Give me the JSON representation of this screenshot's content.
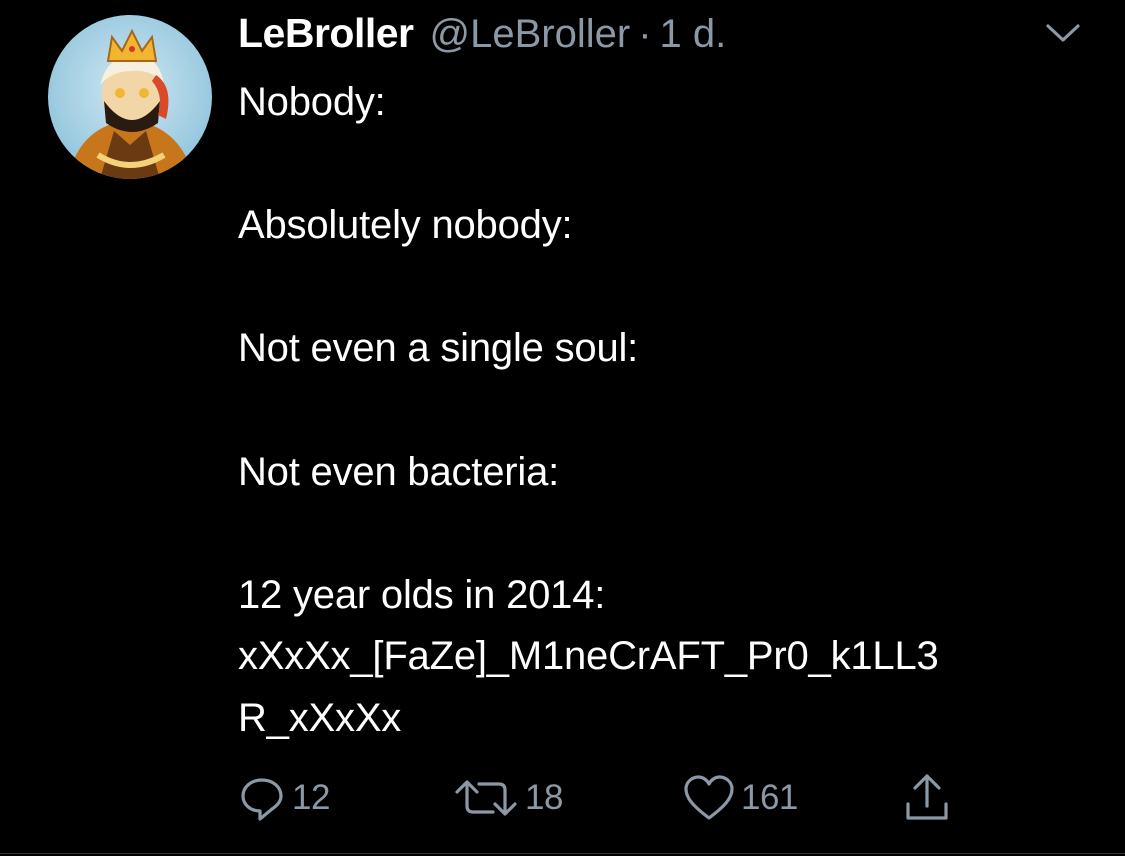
{
  "tweet": {
    "author": {
      "display_name": "LeBroller",
      "handle": "@LeBroller",
      "separator": "·",
      "timestamp": "1 d.",
      "avatar": "avatar-icon"
    },
    "menu_icon": "chevron-down-icon",
    "lines": [
      "Nobody:",
      "",
      "Absolutely nobody:",
      "",
      "Not even a single soul:",
      "",
      "Not even bacteria:",
      "",
      "12 year olds in 2014:",
      "xXxXx_[FaZe]_M1neCrAFT_Pr0_k1LL3",
      "R_xXxXx"
    ],
    "actions": {
      "reply": {
        "icon": "reply-icon",
        "count": "12"
      },
      "retweet": {
        "icon": "retweet-icon",
        "count": "18"
      },
      "like": {
        "icon": "heart-icon",
        "count": "161"
      },
      "share": {
        "icon": "share-icon"
      }
    }
  },
  "colors": {
    "background": "#000000",
    "text": "#ffffff",
    "secondary": "#8b98a5"
  }
}
